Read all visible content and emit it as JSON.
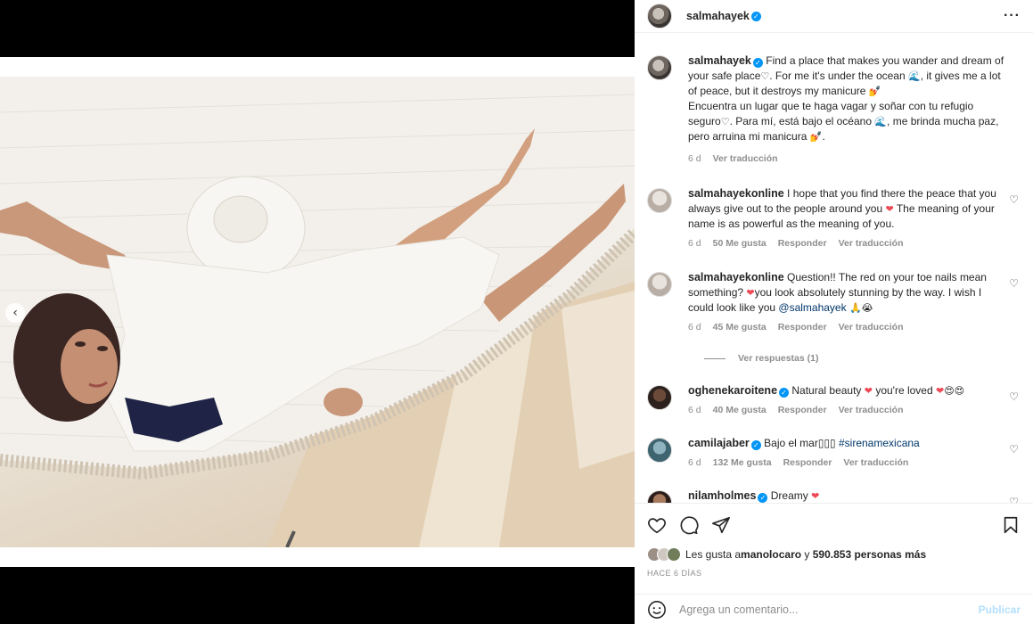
{
  "post_owner": "salmahayek",
  "caption": {
    "user": "salmahayek",
    "en_1": "Find a place that makes you wander and dream of your safe place",
    "en_2": ". For me it's under the ocean ",
    "en_3": ", it gives me a lot of peace, but it destroys my manicure ",
    "es_1": "Encuentra un lugar que te haga vagar y soñar con tu refugio seguro",
    "es_2": ". Para mí, está bajo el océano ",
    "es_3": ", me brinda mucha paz, pero arruina mi manicura ",
    "es_4": ".",
    "heart": "♡",
    "wave": "🌊",
    "nail": "💅",
    "time": "6 d",
    "translate": "Ver traducción"
  },
  "comments": [
    {
      "user": "salmahayekonline",
      "text_1": "I hope that you find there the peace that you always give out to the people around you ",
      "text_2": " The meaning of your name is as powerful as the meaning of you.",
      "time": "6 d",
      "likes": "50 Me gusta",
      "reply": "Responder",
      "translate": "Ver traducción"
    },
    {
      "user": "salmahayekonline",
      "text_1": "Question!! The red on your toe nails mean something? ",
      "text_2": "you look absolutely stunning by the way. I wish I could look like you ",
      "mention": "@salmahayek",
      "time": "6 d",
      "likes": "45 Me gusta",
      "reply": "Responder",
      "translate": "Ver traducción",
      "replies": "Ver respuestas (1)"
    },
    {
      "user": "oghenekaroitene",
      "text_1": "Natural beauty ",
      "text_2": " you're loved ",
      "time": "6 d",
      "likes": "40 Me gusta",
      "reply": "Responder",
      "translate": "Ver traducción"
    },
    {
      "user": "camilajaber",
      "text_1": "Bajo el mar",
      "boxes": "▯▯▯",
      "tag": "#sirenamexicana",
      "time": "6 d",
      "likes": "132 Me gusta",
      "reply": "Responder",
      "translate": "Ver traducción"
    },
    {
      "user": "nilamholmes",
      "text_1": "Dreamy "
    }
  ],
  "likes": {
    "prefix": "Les gusta a ",
    "user": "manolocaro",
    "middle": " y ",
    "count": "590.853 personas más"
  },
  "posted_ago": "HACE 6 DÍAS",
  "add_comment": {
    "placeholder": "Agrega un comentario...",
    "publish": "Publicar"
  },
  "colors": {
    "accent": "#0095f6",
    "heart_red": "#ed4956",
    "link": "#00376b",
    "muted": "#8e8e8e"
  }
}
